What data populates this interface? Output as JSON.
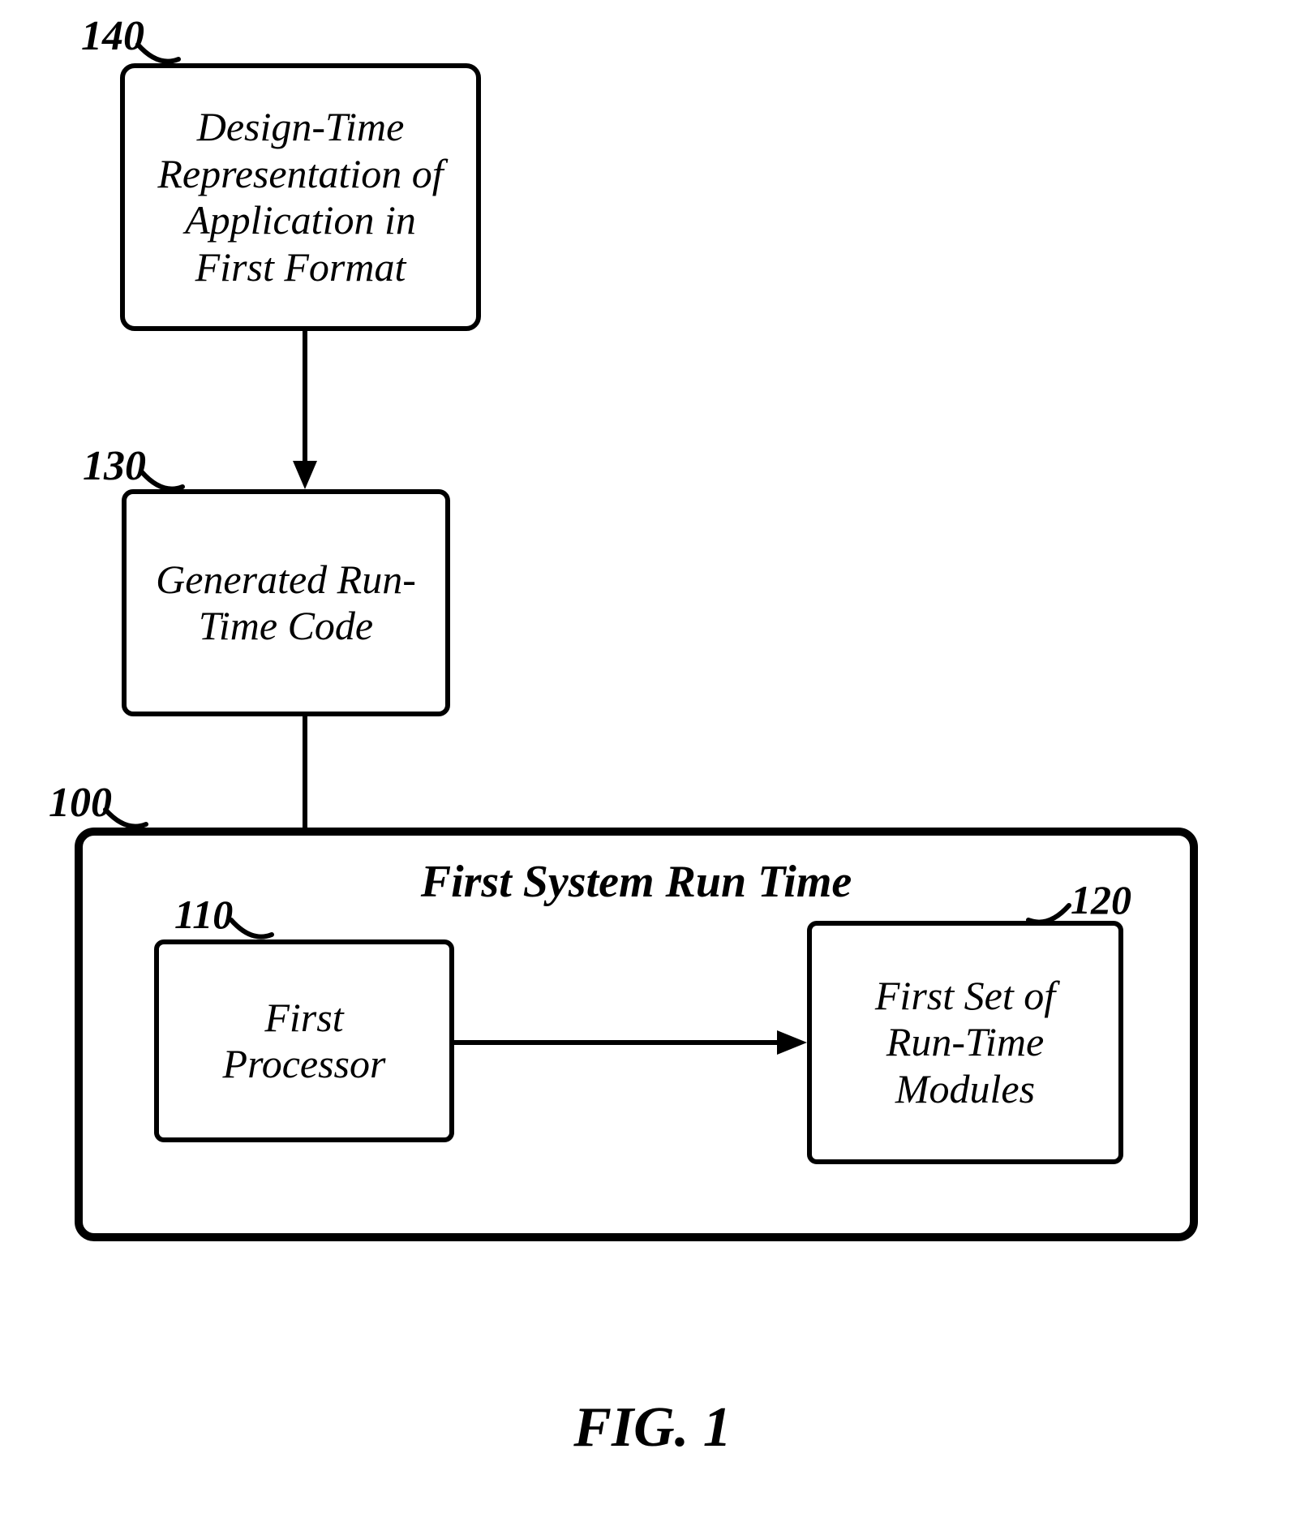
{
  "labels": {
    "l140": "140",
    "l130": "130",
    "l100": "100",
    "l110": "110",
    "l120": "120"
  },
  "boxes": {
    "b140": "Design-Time Representation of Application in First Format",
    "b130": "Generated Run-Time Code",
    "b100_title": "First System Run Time",
    "b110": "First Processor",
    "b120": "First Set of Run-Time Modules"
  },
  "caption": "FIG. 1"
}
